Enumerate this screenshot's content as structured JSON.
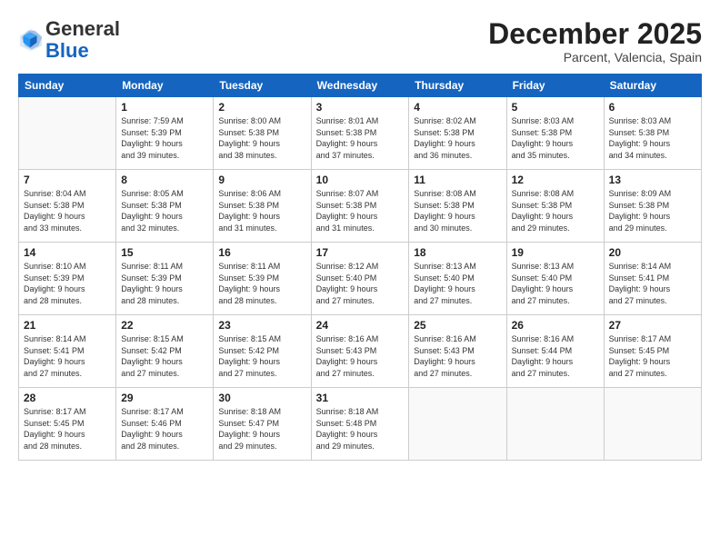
{
  "logo": {
    "general": "General",
    "blue": "Blue"
  },
  "title": {
    "month_year": "December 2025",
    "location": "Parcent, Valencia, Spain"
  },
  "headers": [
    "Sunday",
    "Monday",
    "Tuesday",
    "Wednesday",
    "Thursday",
    "Friday",
    "Saturday"
  ],
  "weeks": [
    [
      {
        "day": "",
        "info": ""
      },
      {
        "day": "1",
        "info": "Sunrise: 7:59 AM\nSunset: 5:39 PM\nDaylight: 9 hours\nand 39 minutes."
      },
      {
        "day": "2",
        "info": "Sunrise: 8:00 AM\nSunset: 5:38 PM\nDaylight: 9 hours\nand 38 minutes."
      },
      {
        "day": "3",
        "info": "Sunrise: 8:01 AM\nSunset: 5:38 PM\nDaylight: 9 hours\nand 37 minutes."
      },
      {
        "day": "4",
        "info": "Sunrise: 8:02 AM\nSunset: 5:38 PM\nDaylight: 9 hours\nand 36 minutes."
      },
      {
        "day": "5",
        "info": "Sunrise: 8:03 AM\nSunset: 5:38 PM\nDaylight: 9 hours\nand 35 minutes."
      },
      {
        "day": "6",
        "info": "Sunrise: 8:03 AM\nSunset: 5:38 PM\nDaylight: 9 hours\nand 34 minutes."
      }
    ],
    [
      {
        "day": "7",
        "info": "Sunrise: 8:04 AM\nSunset: 5:38 PM\nDaylight: 9 hours\nand 33 minutes."
      },
      {
        "day": "8",
        "info": "Sunrise: 8:05 AM\nSunset: 5:38 PM\nDaylight: 9 hours\nand 32 minutes."
      },
      {
        "day": "9",
        "info": "Sunrise: 8:06 AM\nSunset: 5:38 PM\nDaylight: 9 hours\nand 31 minutes."
      },
      {
        "day": "10",
        "info": "Sunrise: 8:07 AM\nSunset: 5:38 PM\nDaylight: 9 hours\nand 31 minutes."
      },
      {
        "day": "11",
        "info": "Sunrise: 8:08 AM\nSunset: 5:38 PM\nDaylight: 9 hours\nand 30 minutes."
      },
      {
        "day": "12",
        "info": "Sunrise: 8:08 AM\nSunset: 5:38 PM\nDaylight: 9 hours\nand 29 minutes."
      },
      {
        "day": "13",
        "info": "Sunrise: 8:09 AM\nSunset: 5:38 PM\nDaylight: 9 hours\nand 29 minutes."
      }
    ],
    [
      {
        "day": "14",
        "info": "Sunrise: 8:10 AM\nSunset: 5:39 PM\nDaylight: 9 hours\nand 28 minutes."
      },
      {
        "day": "15",
        "info": "Sunrise: 8:11 AM\nSunset: 5:39 PM\nDaylight: 9 hours\nand 28 minutes."
      },
      {
        "day": "16",
        "info": "Sunrise: 8:11 AM\nSunset: 5:39 PM\nDaylight: 9 hours\nand 28 minutes."
      },
      {
        "day": "17",
        "info": "Sunrise: 8:12 AM\nSunset: 5:40 PM\nDaylight: 9 hours\nand 27 minutes."
      },
      {
        "day": "18",
        "info": "Sunrise: 8:13 AM\nSunset: 5:40 PM\nDaylight: 9 hours\nand 27 minutes."
      },
      {
        "day": "19",
        "info": "Sunrise: 8:13 AM\nSunset: 5:40 PM\nDaylight: 9 hours\nand 27 minutes."
      },
      {
        "day": "20",
        "info": "Sunrise: 8:14 AM\nSunset: 5:41 PM\nDaylight: 9 hours\nand 27 minutes."
      }
    ],
    [
      {
        "day": "21",
        "info": "Sunrise: 8:14 AM\nSunset: 5:41 PM\nDaylight: 9 hours\nand 27 minutes."
      },
      {
        "day": "22",
        "info": "Sunrise: 8:15 AM\nSunset: 5:42 PM\nDaylight: 9 hours\nand 27 minutes."
      },
      {
        "day": "23",
        "info": "Sunrise: 8:15 AM\nSunset: 5:42 PM\nDaylight: 9 hours\nand 27 minutes."
      },
      {
        "day": "24",
        "info": "Sunrise: 8:16 AM\nSunset: 5:43 PM\nDaylight: 9 hours\nand 27 minutes."
      },
      {
        "day": "25",
        "info": "Sunrise: 8:16 AM\nSunset: 5:43 PM\nDaylight: 9 hours\nand 27 minutes."
      },
      {
        "day": "26",
        "info": "Sunrise: 8:16 AM\nSunset: 5:44 PM\nDaylight: 9 hours\nand 27 minutes."
      },
      {
        "day": "27",
        "info": "Sunrise: 8:17 AM\nSunset: 5:45 PM\nDaylight: 9 hours\nand 27 minutes."
      }
    ],
    [
      {
        "day": "28",
        "info": "Sunrise: 8:17 AM\nSunset: 5:45 PM\nDaylight: 9 hours\nand 28 minutes."
      },
      {
        "day": "29",
        "info": "Sunrise: 8:17 AM\nSunset: 5:46 PM\nDaylight: 9 hours\nand 28 minutes."
      },
      {
        "day": "30",
        "info": "Sunrise: 8:18 AM\nSunset: 5:47 PM\nDaylight: 9 hours\nand 29 minutes."
      },
      {
        "day": "31",
        "info": "Sunrise: 8:18 AM\nSunset: 5:48 PM\nDaylight: 9 hours\nand 29 minutes."
      },
      {
        "day": "",
        "info": ""
      },
      {
        "day": "",
        "info": ""
      },
      {
        "day": "",
        "info": ""
      }
    ]
  ]
}
